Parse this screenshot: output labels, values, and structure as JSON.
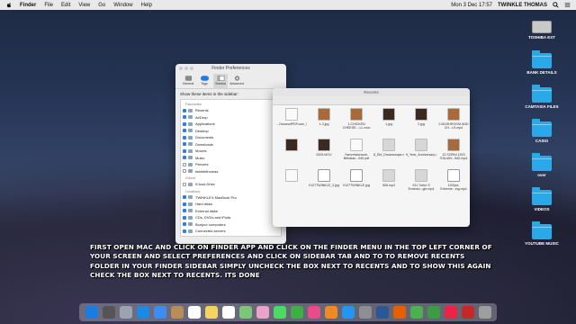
{
  "menubar": {
    "items": [
      "Finder",
      "File",
      "Edit",
      "View",
      "Go",
      "Window",
      "Help"
    ],
    "clock": "Mon 3 Dec 17:57",
    "user": "TWINKLE THOMAS"
  },
  "desktop": [
    {
      "label": "TOSHIBA EXT",
      "kind": "drive"
    },
    {
      "label": "BANK DETAILS",
      "kind": "folder"
    },
    {
      "label": "CAMTASIA FILES",
      "kind": "folder"
    },
    {
      "label": "CASIO",
      "kind": "folder"
    },
    {
      "label": "over",
      "kind": "folder"
    },
    {
      "label": "VIDEOS",
      "kind": "folder"
    },
    {
      "label": "YOUTUBE MUSIC",
      "kind": "folder"
    }
  ],
  "prefs": {
    "title": "Finder Preferences",
    "tabs": [
      "General",
      "Tags",
      "Sidebar",
      "Advanced"
    ],
    "instruction": "Show these items in the sidebar:",
    "favourites_label": "Favourites",
    "favourites": [
      {
        "label": "Recents",
        "checked": true
      },
      {
        "label": "AirDrop",
        "checked": true
      },
      {
        "label": "Applications",
        "checked": true
      },
      {
        "label": "Desktop",
        "checked": true
      },
      {
        "label": "Documents",
        "checked": true
      },
      {
        "label": "Downloads",
        "checked": true
      },
      {
        "label": "Movies",
        "checked": true
      },
      {
        "label": "Music",
        "checked": true
      },
      {
        "label": "Pictures",
        "checked": false
      },
      {
        "label": "twinklethomas",
        "checked": false
      }
    ],
    "icloud_label": "iCloud",
    "icloud": [
      {
        "label": "iCloud Drive",
        "checked": false
      }
    ],
    "locations_label": "Locations",
    "locations": [
      {
        "label": "TWINKLE's MacBook Pro",
        "checked": true
      },
      {
        "label": "Hard disks",
        "checked": true
      },
      {
        "label": "External disks",
        "checked": true
      },
      {
        "label": "CDs, DVDs and iPods",
        "checked": true
      },
      {
        "label": "Bonjour computers",
        "checked": true
      },
      {
        "label": "Connected servers",
        "checked": true
      }
    ]
  },
  "recents": {
    "title": "Recents",
    "files": [
      {
        "name": "...OceanofPDF.com_Sophie...orld.pdf",
        "kind": "doc"
      },
      {
        "name": "1-3.jpg",
        "kind": "food"
      },
      {
        "name": "1.CHICKEN CHEESE....LL.mov",
        "kind": "food"
      },
      {
        "name": "1.jpg",
        "kind": "dark"
      },
      {
        "name": "2.jpg",
        "kind": "dark"
      },
      {
        "name": "2.MUSHROOM AND CH...LS.mp4",
        "kind": "food"
      },
      {
        "name": "",
        "kind": "dark"
      },
      {
        "name": "0003.MOV",
        "kind": "dark"
      },
      {
        "name": "7secretsforwork-lifebalan...040.pdf",
        "kind": "doc"
      },
      {
        "name": "8_Ekt_Dreamscape.mp3",
        "kind": "music"
      },
      {
        "name": "9_Year_Anniversary.mp3",
        "kind": "music"
      },
      {
        "name": "12.SORNI 1923 ITALIAN...INO.mp4",
        "kind": "food"
      },
      {
        "name": "",
        "kind": "doc"
      },
      {
        "name": "0127TWINKLE_3.jpg",
        "kind": "video"
      },
      {
        "name": "0127TWINKLE.jpg",
        "kind": "video"
      },
      {
        "name": "555.mp3",
        "kind": "music"
      },
      {
        "name": "911 Turbo S Exclusiv...gie.mp4",
        "kind": "music"
      },
      {
        "name": "1200px-Extreme...ing.mp4",
        "kind": "video"
      }
    ]
  },
  "instruction_text": "FIRST OPEN MAC AND CLICK ON FINDER APP AND CLICK ON THE FINDER MENU IN THE TOP LEFT CORNER OF YOUR SCREEN AND SELECT PREFERENCES AND CLICK ON SIDEBAR TAB AND TO TO REMOVE RECENTS FOLDER IN YOUR FINDER SIDEBAR SIMPLY UNCHECK THE BOX NEXT TO RECENTS AND TO SHOW THIS AGAIN CHECK THE BOX NEXT TO RECENTS. ITS DONE",
  "dock": [
    "finder-icon",
    "siri-icon",
    "launchpad-icon",
    "safari-icon",
    "mail-icon",
    "contacts-icon",
    "calendar-icon",
    "notes-icon",
    "reminders-icon",
    "maps-icon",
    "photos-icon",
    "messages-icon",
    "facetime-icon",
    "itunes-icon",
    "ibooks-icon",
    "appstore-icon",
    "preferences-icon",
    "word-icon",
    "firefox-icon",
    "chrome-icon",
    "camtasia-icon",
    "screenflow-icon",
    "photobooth-icon",
    "trash-icon"
  ],
  "dock_colors": [
    "#1b7ce0",
    "#555",
    "#9ba3b0",
    "#1e88e5",
    "#3d8cf0",
    "#b98d5a",
    "#fff",
    "#f4d35e",
    "#fff",
    "#7bc67b",
    "#e9a3c9",
    "#4cd964",
    "#3cb043",
    "#ea4c89",
    "#f08a24",
    "#2196f3",
    "#8e8e93",
    "#2b5797",
    "#e66000",
    "#4caf50",
    "#3a9d46",
    "#e24",
    "#c62828",
    "#9e9e9e"
  ]
}
